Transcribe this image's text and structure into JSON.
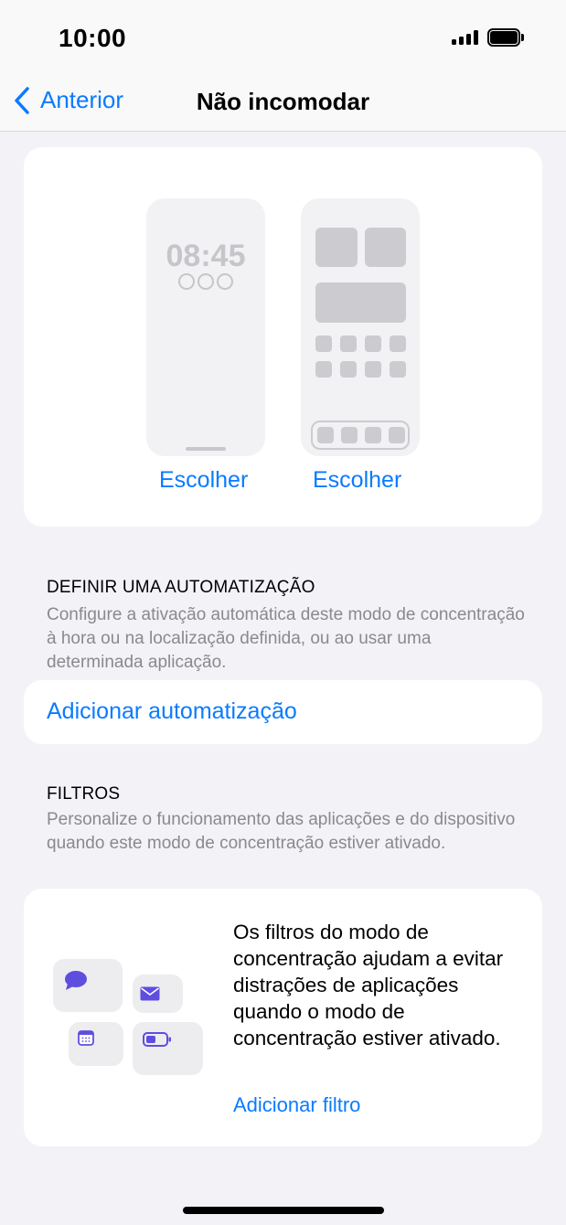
{
  "status_bar": {
    "time": "10:00"
  },
  "nav": {
    "back_label": "Anterior",
    "title": "Não incomodar"
  },
  "screens": {
    "lock_time": "08:45",
    "choose_lock": "Escolher",
    "choose_home": "Escolher"
  },
  "automation": {
    "header": "DEFINIR UMA AUTOMATIZAÇÃO",
    "description": "Configure a ativação automática deste modo de concentração à hora ou na localização definida, ou ao usar uma determinada aplicação.",
    "add_label": "Adicionar automatização"
  },
  "filters": {
    "header": "FILTROS",
    "description": "Personalize o funcionamento das aplicações e do dispositivo quando este modo de concentração estiver ativado.",
    "card_text": "Os filtros do modo de concentração ajudam a evitar distrações de aplicações quando o modo de concentração estiver ativado.",
    "add_label": "Adicionar filtro"
  },
  "colors": {
    "accent": "#0a7bff",
    "icon_purple": "#5e4ee0",
    "background": "#f2f2f7"
  }
}
